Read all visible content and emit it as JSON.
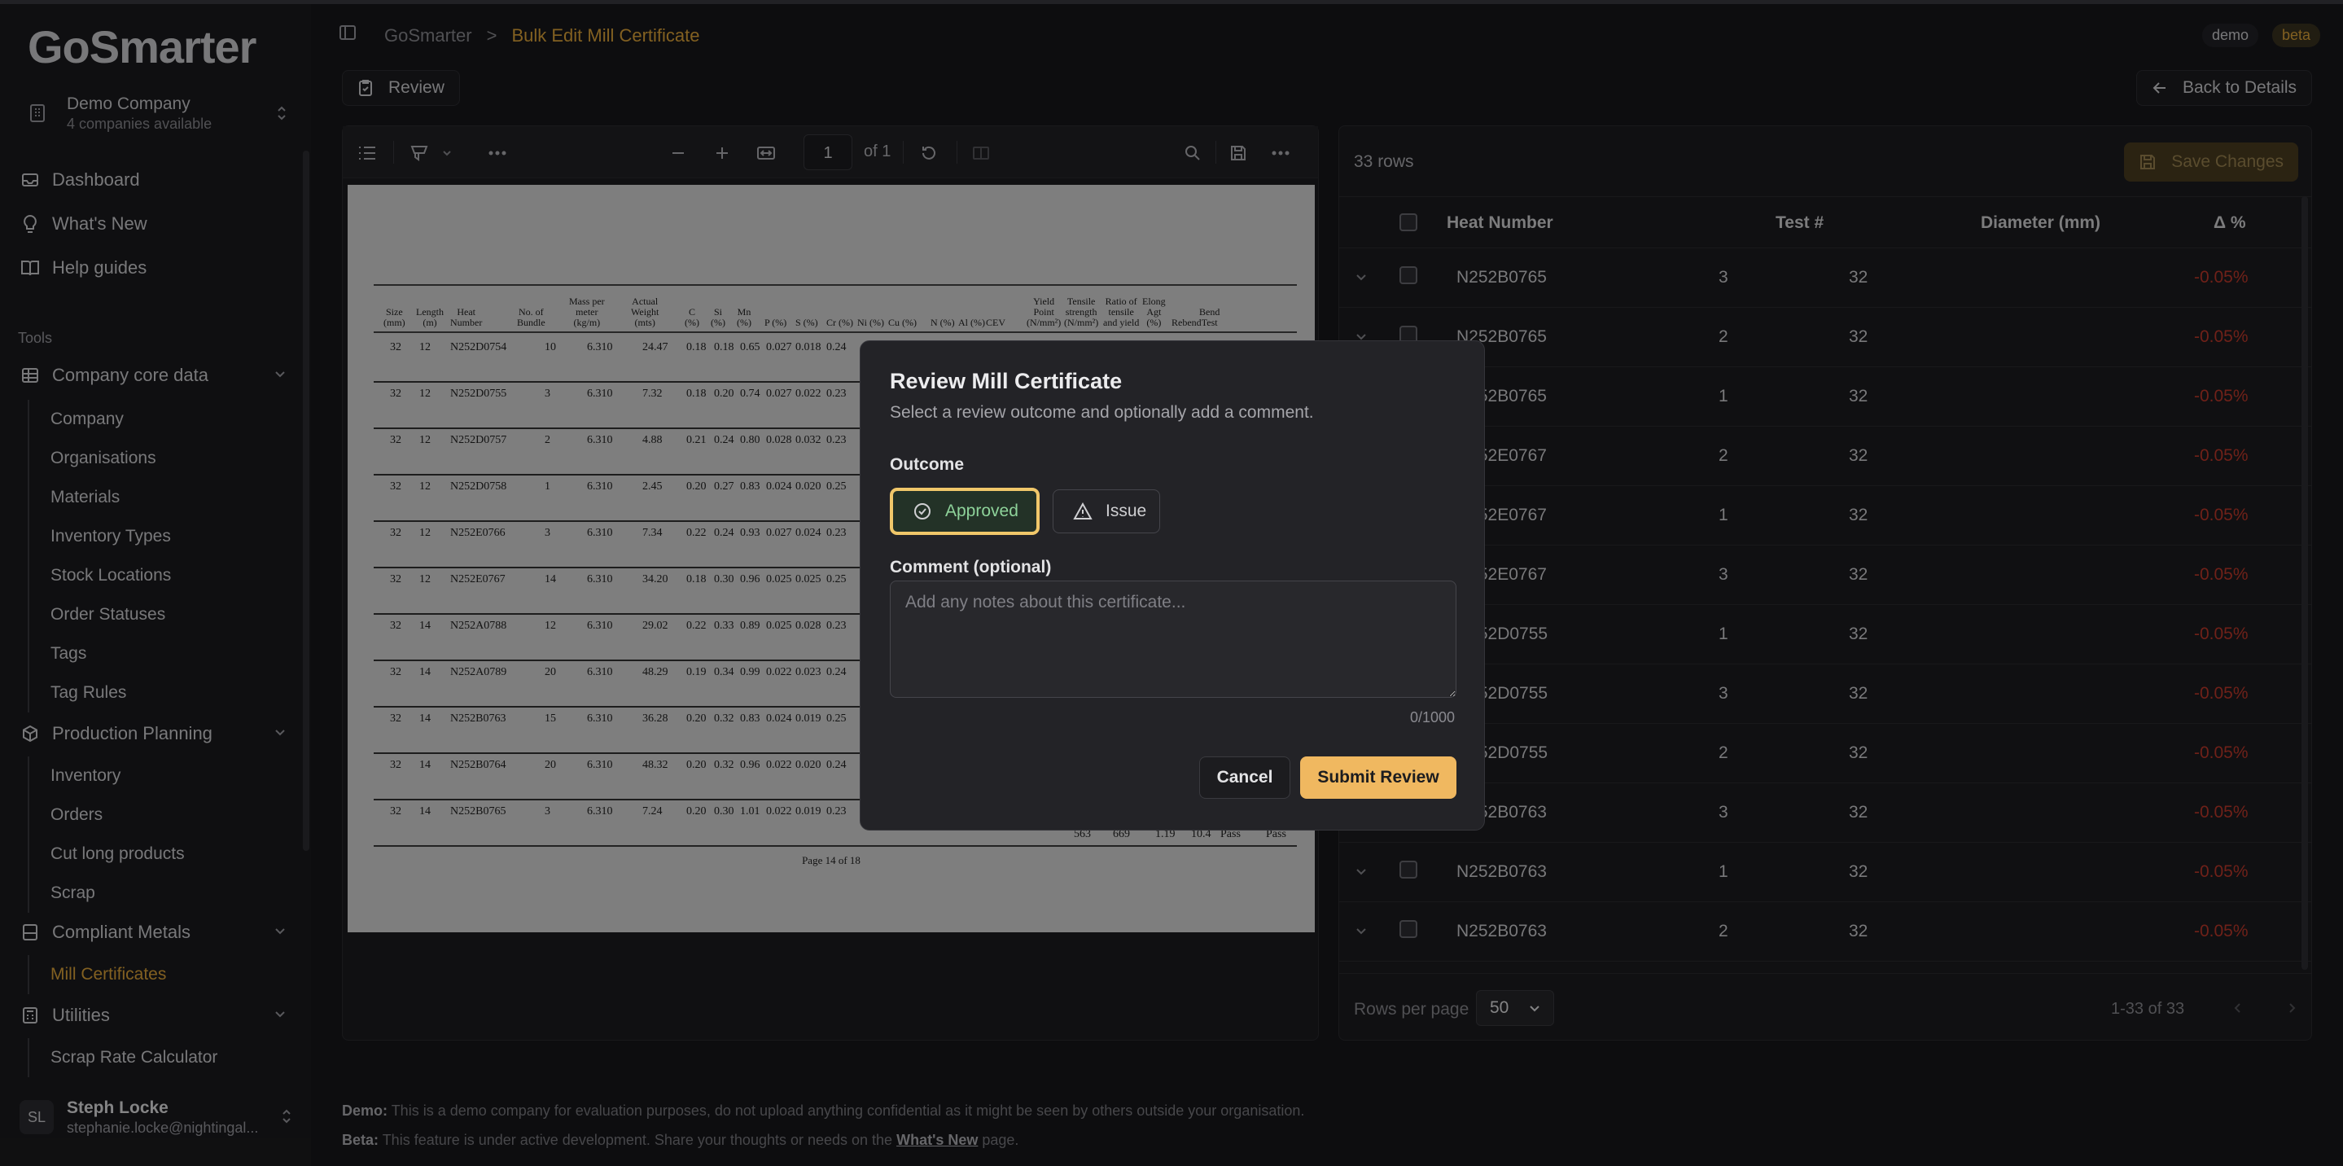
{
  "app": {
    "logo_prefix": "Go",
    "logo_suffix": "Smarter",
    "brand_color": "#e0a63a"
  },
  "company": {
    "name": "Demo Company",
    "sub": "4 companies available"
  },
  "nav": {
    "dashboard": "Dashboard",
    "whats_new": "What's New",
    "help_guides": "Help guides",
    "tools_label": "Tools"
  },
  "groups": {
    "core": {
      "label": "Company core data",
      "items": [
        "Company",
        "Organisations",
        "Materials",
        "Inventory Types",
        "Stock Locations",
        "Order Statuses",
        "Tags",
        "Tag Rules"
      ]
    },
    "planning": {
      "label": "Production Planning",
      "items": [
        "Inventory",
        "Orders",
        "Cut long products",
        "Scrap"
      ]
    },
    "metals": {
      "label": "Compliant Metals",
      "items": [
        "Mill Certificates"
      ]
    },
    "utilities": {
      "label": "Utilities",
      "items": [
        "Scrap Rate Calculator"
      ]
    }
  },
  "user": {
    "initials": "SL",
    "name": "Steph Locke",
    "email": "stephanie.locke@nightingal..."
  },
  "header": {
    "crumb_root": "GoSmarter",
    "crumb_sep": ">",
    "crumb_current": "Bulk Edit Mill Certificate",
    "badge_demo": "demo",
    "badge_beta": "beta"
  },
  "actions": {
    "review": "Review",
    "back": "Back to Details"
  },
  "pdf": {
    "page": "1",
    "page_of": "of 1",
    "headers": [
      [
        "Size",
        "(mm)"
      ],
      [
        "Length",
        "(m)"
      ],
      [
        "Heat",
        "Number"
      ],
      [
        "No. of",
        "Bundle"
      ],
      [
        "Mass per",
        "meter",
        "(kg/m)"
      ],
      [
        "Actual",
        "Weight",
        "(mts)"
      ],
      [
        "C",
        "(%)"
      ],
      [
        "Si",
        "(%)"
      ],
      [
        "Mn",
        "(%)"
      ],
      [
        "P (%)"
      ],
      [
        "S (%)"
      ],
      [
        "Cr (%)"
      ],
      [
        "Ni (%)"
      ],
      [
        "Cu (%)"
      ],
      [
        "N (%)"
      ],
      [
        "Al (%)"
      ],
      [
        "CEV"
      ],
      [
        "Yield",
        "Point",
        "(N/mm²)"
      ],
      [
        "Tensile",
        "strength",
        "(N/mm²)"
      ],
      [
        "Ratio of",
        "tensile",
        "and yield"
      ],
      [
        "Elong",
        "Agt",
        "(%)"
      ],
      [
        "Rebend"
      ],
      [
        "Bend",
        "Test"
      ]
    ],
    "rows": [
      [
        "32",
        "12",
        "N252D0754",
        "10",
        "6.310",
        "24.47",
        "0.18",
        "0.18",
        "0.65",
        "0.027",
        "0.018",
        "0.24"
      ],
      [
        "32",
        "12",
        "N252D0755",
        "3",
        "6.310",
        "7.32",
        "0.18",
        "0.20",
        "0.74",
        "0.027",
        "0.022",
        "0.23"
      ],
      [
        "32",
        "12",
        "N252D0757",
        "2",
        "6.310",
        "4.88",
        "0.21",
        "0.24",
        "0.80",
        "0.028",
        "0.032",
        "0.23"
      ],
      [
        "32",
        "12",
        "N252D0758",
        "1",
        "6.310",
        "2.45",
        "0.20",
        "0.27",
        "0.83",
        "0.024",
        "0.020",
        "0.25"
      ],
      [
        "32",
        "12",
        "N252E0766",
        "3",
        "6.310",
        "7.34",
        "0.22",
        "0.24",
        "0.93",
        "0.027",
        "0.024",
        "0.23"
      ],
      [
        "32",
        "12",
        "N252E0767",
        "14",
        "6.310",
        "34.20",
        "0.18",
        "0.30",
        "0.96",
        "0.025",
        "0.025",
        "0.25"
      ],
      [
        "32",
        "14",
        "N252A0788",
        "12",
        "6.310",
        "29.02",
        "0.22",
        "0.33",
        "0.89",
        "0.025",
        "0.028",
        "0.23"
      ],
      [
        "32",
        "14",
        "N252A0789",
        "20",
        "6.310",
        "48.29",
        "0.19",
        "0.34",
        "0.99",
        "0.022",
        "0.023",
        "0.24"
      ],
      [
        "32",
        "14",
        "N252B0763",
        "15",
        "6.310",
        "36.28",
        "0.20",
        "0.32",
        "0.83",
        "0.024",
        "0.019",
        "0.25"
      ],
      [
        "32",
        "14",
        "N252B0764",
        "20",
        "6.310",
        "48.32",
        "0.20",
        "0.32",
        "0.96",
        "0.022",
        "0.020",
        "0.24"
      ],
      [
        "32",
        "14",
        "N252B0765",
        "3",
        "6.310",
        "7.24",
        "0.20",
        "0.30",
        "1.01",
        "0.022",
        "0.019",
        "0.23"
      ]
    ],
    "last_row": [
      "563",
      "669",
      "1.19",
      "10.4",
      "Pass",
      "Pass"
    ],
    "footer": "Page 14 of 18"
  },
  "table": {
    "rows_count": "33 rows",
    "save_label": "Save Changes",
    "columns": [
      "Heat Number",
      "Test #",
      "Diameter (mm)",
      "Δ %"
    ],
    "rows": [
      [
        "N252B0765",
        "3",
        "32",
        "-0.05%"
      ],
      [
        "N252B0765",
        "2",
        "32",
        "-0.05%"
      ],
      [
        "N252B0765",
        "1",
        "32",
        "-0.05%"
      ],
      [
        "N252E0767",
        "2",
        "32",
        "-0.05%"
      ],
      [
        "N252E0767",
        "1",
        "32",
        "-0.05%"
      ],
      [
        "N252E0767",
        "3",
        "32",
        "-0.05%"
      ],
      [
        "N252D0755",
        "1",
        "32",
        "-0.05%"
      ],
      [
        "N252D0755",
        "3",
        "32",
        "-0.05%"
      ],
      [
        "N252D0755",
        "2",
        "32",
        "-0.05%"
      ],
      [
        "N252B0763",
        "3",
        "32",
        "-0.05%"
      ],
      [
        "N252B0763",
        "1",
        "32",
        "-0.05%"
      ],
      [
        "N252B0763",
        "2",
        "32",
        "-0.05%"
      ]
    ],
    "rows_per_page_label": "Rows per page",
    "rows_per_page": "50",
    "range": "1-33 of 33"
  },
  "notes": {
    "demo_label": "Demo:",
    "demo_text": " This is a demo company for evaluation purposes, do not upload anything confidential as it might be seen by others outside your organisation.",
    "beta_label": "Beta:",
    "beta_text": " This feature is under active development. Share your thoughts or needs on the ",
    "beta_link": "What's New",
    "beta_end": " page."
  },
  "modal": {
    "title": "Review Mill Certificate",
    "description": "Select a review outcome and optionally add a comment.",
    "outcome_label": "Outcome",
    "approved": "Approved",
    "issue": "Issue",
    "comment_label": "Comment (optional)",
    "comment_placeholder": "Add any notes about this certificate...",
    "comment_count": "0/1000",
    "cancel": "Cancel",
    "submit": "Submit Review",
    "approved_color": "#8ed39a",
    "submit_color": "#f0b860"
  }
}
